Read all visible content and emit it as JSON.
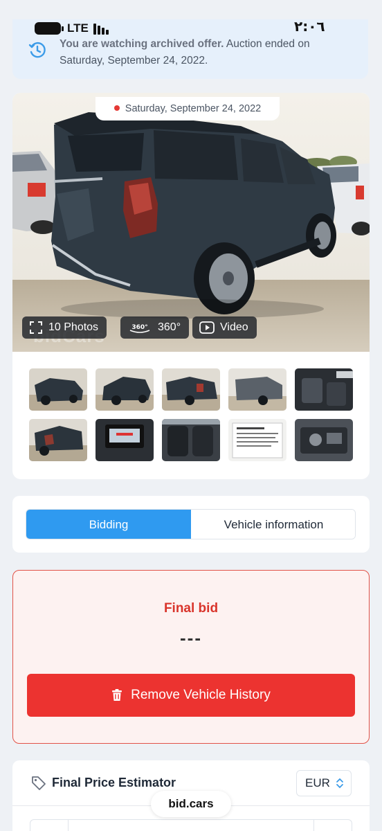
{
  "status_bar": {
    "network": "LTE",
    "time": "٢:٠٦"
  },
  "banner": {
    "strong_text": "You are watching archived offer.",
    "text": " Auction ended on Saturday, September 24, 2022."
  },
  "gallery": {
    "date": "Saturday, September 24, 2022",
    "photos_label": "10 Photos",
    "view360_label": "360°",
    "view360_icon_text": "360°",
    "video_label": "Video",
    "watermark": "bidCars",
    "thumbnail_count": 10
  },
  "tabs": [
    {
      "label": "Bidding",
      "active": true
    },
    {
      "label": "Vehicle information",
      "active": false
    }
  ],
  "final_bid": {
    "title": "Final bid",
    "value": "---",
    "remove_button": "Remove Vehicle History"
  },
  "estimator": {
    "title": "Final Price Estimator",
    "currency": "EUR"
  },
  "site": "bid.cars",
  "colors": {
    "accent_blue": "#2f9af0",
    "danger_red": "#ec3330",
    "bid_red": "#d9342b",
    "banner_bg": "#e6f0fb"
  }
}
